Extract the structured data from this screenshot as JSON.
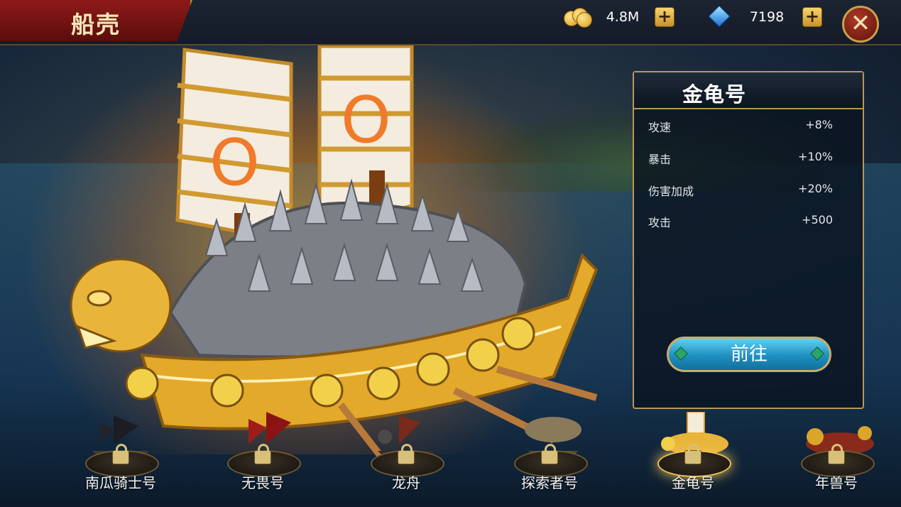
{
  "header": {
    "title": "船壳"
  },
  "resources": {
    "gold": {
      "value": "4.8M",
      "icon": "gold-coins-icon"
    },
    "gems": {
      "value": "7198",
      "icon": "diamond-icon"
    }
  },
  "panel": {
    "title": "金龟号",
    "stats": [
      {
        "label": "攻速",
        "value": "+8%"
      },
      {
        "label": "暴击",
        "value": "+10%"
      },
      {
        "label": "伤害加成",
        "value": "+20%"
      },
      {
        "label": "攻击",
        "value": "+500"
      }
    ],
    "go_button": "前往"
  },
  "ships": [
    {
      "name": "南瓜骑士号",
      "locked": true,
      "selected": false
    },
    {
      "name": "无畏号",
      "locked": true,
      "selected": false
    },
    {
      "name": "龙舟",
      "locked": true,
      "selected": false
    },
    {
      "name": "探索者号",
      "locked": true,
      "selected": false
    },
    {
      "name": "金龟号",
      "locked": true,
      "selected": true
    },
    {
      "name": "年兽号",
      "locked": true,
      "selected": false
    }
  ],
  "colors": {
    "accent_gold": "#c9a24a",
    "button_blue": "#1e8fc0",
    "title_red": "#8e1a1a"
  }
}
